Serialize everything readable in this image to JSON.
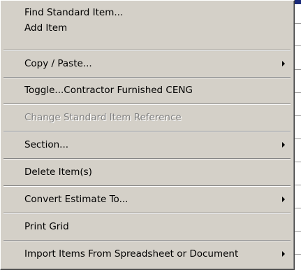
{
  "context_menu": {
    "items": [
      {
        "label": "Find Standard Item..."
      },
      {
        "label": "Add Item"
      },
      {
        "label": "Copy / Paste..."
      },
      {
        "label": "Toggle...Contractor Furnished CENG"
      },
      {
        "label": "Change  Standard Item Reference"
      },
      {
        "label": "Section..."
      },
      {
        "label": "Delete Item(s)"
      },
      {
        "label": "Convert Estimate To..."
      },
      {
        "label": "Print Grid"
      },
      {
        "label": "Import Items From Spreadsheet or Document"
      }
    ]
  },
  "colors": {
    "menu_bg": "#d4d0c8",
    "disabled_text": "#808080",
    "background_window_bar": "#1a2a7a"
  }
}
